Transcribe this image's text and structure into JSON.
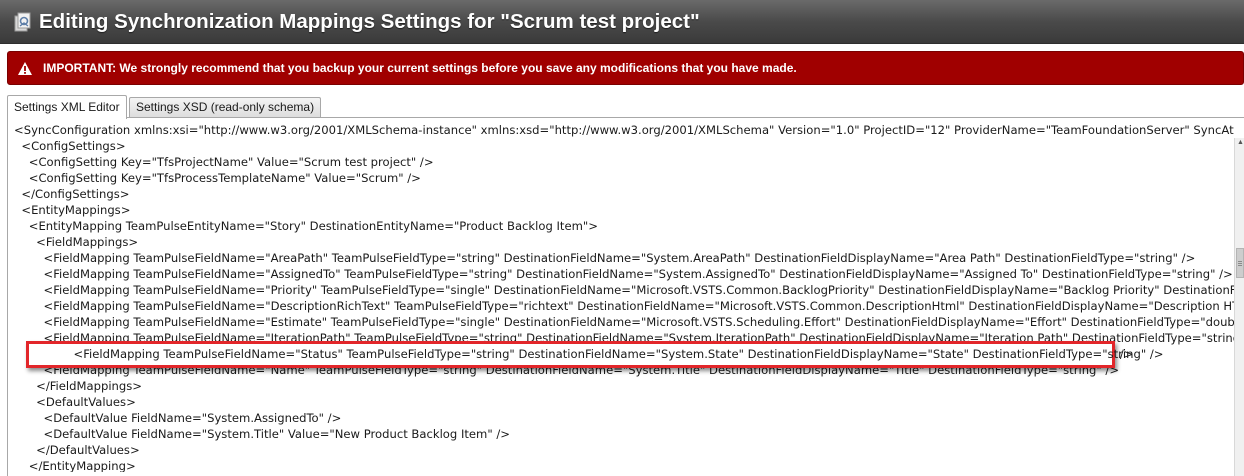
{
  "window": {
    "title": "Editing Synchronization Mappings Settings for \"Scrum test project\"",
    "icon": "sync-settings-icon"
  },
  "warning": {
    "icon": "warning-triangle-icon",
    "text": "IMPORTANT: We strongly recommend that you backup your current settings before you save any modifications that you have made."
  },
  "tabs": [
    {
      "label": "Settings XML Editor",
      "active": true
    },
    {
      "label": "Settings XSD (read-only schema)",
      "active": false
    }
  ],
  "editor": {
    "lines": [
      "<SyncConfiguration xmlns:xsi=\"http://www.w3.org/2001/XMLSchema-instance\" xmlns:xsd=\"http://www.w3.org/2001/XMLSchema\" Version=\"1.0\" ProjectID=\"12\" ProviderName=\"TeamFoundationServer\" SyncAttachm",
      "  <ConfigSettings>",
      "    <ConfigSetting Key=\"TfsProjectName\" Value=\"Scrum test project\" />",
      "    <ConfigSetting Key=\"TfsProcessTemplateName\" Value=\"Scrum\" />",
      "  </ConfigSettings>",
      "  <EntityMappings>",
      "    <EntityMapping TeamPulseEntityName=\"Story\" DestinationEntityName=\"Product Backlog Item\">",
      "      <FieldMappings>",
      "        <FieldMapping TeamPulseFieldName=\"AreaPath\" TeamPulseFieldType=\"string\" DestinationFieldName=\"System.AreaPath\" DestinationFieldDisplayName=\"Area Path\" DestinationFieldType=\"string\" />",
      "        <FieldMapping TeamPulseFieldName=\"AssignedTo\" TeamPulseFieldType=\"string\" DestinationFieldName=\"System.AssignedTo\" DestinationFieldDisplayName=\"Assigned To\" DestinationFieldType=\"string\" />",
      "        <FieldMapping TeamPulseFieldName=\"Priority\" TeamPulseFieldType=\"single\" DestinationFieldName=\"Microsoft.VSTS.Common.BacklogPriority\" DestinationFieldDisplayName=\"Backlog Priority\" DestinationFieldType=",
      "        <FieldMapping TeamPulseFieldName=\"DescriptionRichText\" TeamPulseFieldType=\"richtext\" DestinationFieldName=\"Microsoft.VSTS.Common.DescriptionHtml\" DestinationFieldDisplayName=\"Description HTML\" Des",
      "        <FieldMapping TeamPulseFieldName=\"Estimate\" TeamPulseFieldType=\"single\" DestinationFieldName=\"Microsoft.VSTS.Scheduling.Effort\" DestinationFieldDisplayName=\"Effort\" DestinationFieldType=\"double\" />",
      "        <FieldMapping TeamPulseFieldName=\"IterationPath\" TeamPulseFieldType=\"string\" DestinationFieldName=\"System.IterationPath\" DestinationFieldDisplayName=\"Iteration Path\" DestinationFieldType=\"string\" />",
      "        <FieldMapping TeamPulseFieldName=\"Status\" TeamPulseFieldType=\"string\" DestinationFieldName=\"System.State\" DestinationFieldDisplayName=\"State\" DestinationFieldType=\"string\" />",
      "        <FieldMapping TeamPulseFieldName=\"Name\" TeamPulseFieldType=\"string\" DestinationFieldName=\"System.Title\" DestinationFieldDisplayName=\"Title\" DestinationFieldType=\"string\" />",
      "      </FieldMappings>",
      "      <DefaultValues>",
      "        <DefaultValue FieldName=\"System.AssignedTo\" />",
      "        <DefaultValue FieldName=\"System.Title\" Value=\"New Product Backlog Item\" />",
      "      </DefaultValues>",
      "    </EntityMapping>"
    ],
    "highlighted_line": "        <FieldMapping TeamPulseFieldName=\"Status\" TeamPulseFieldType=\"string\" DestinationFieldName=\"System.State\" DestinationFieldDisplayName=\"State\" DestinationFieldType=\"string\" />"
  },
  "colors": {
    "titlebar": "#4a4a4a",
    "warning_bg": "#a00000",
    "highlight_border": "#e2262a"
  }
}
